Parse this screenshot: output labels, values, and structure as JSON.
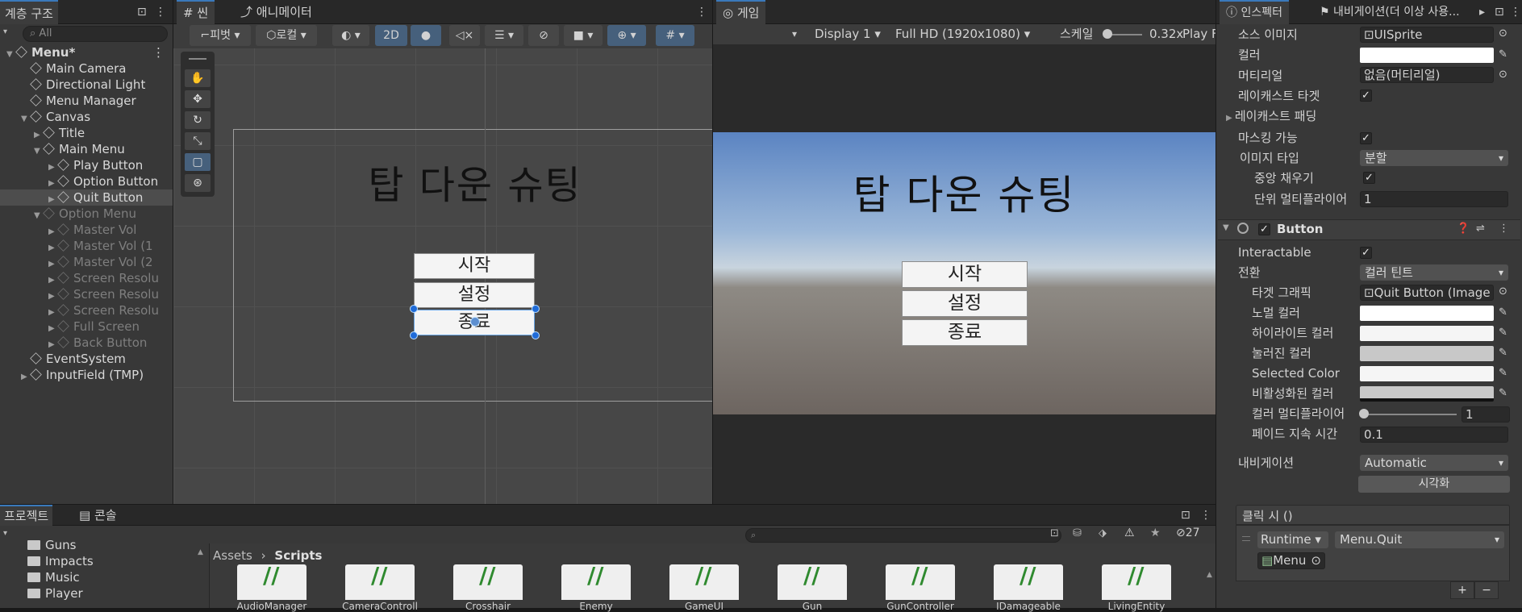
{
  "hierarchy": {
    "tab": "계층 구조",
    "search_placeholder": "All",
    "items": [
      {
        "label": "Menu*",
        "depth": 0,
        "state": "scene"
      },
      {
        "label": "Main Camera",
        "depth": 1,
        "state": "normal"
      },
      {
        "label": "Directional Light",
        "depth": 1,
        "state": "normal"
      },
      {
        "label": "Menu Manager",
        "depth": 1,
        "state": "normal"
      },
      {
        "label": "Canvas",
        "depth": 1,
        "state": "expanded"
      },
      {
        "label": "Title",
        "depth": 2,
        "state": "collapsed"
      },
      {
        "label": "Main Menu",
        "depth": 2,
        "state": "expanded"
      },
      {
        "label": "Play Button",
        "depth": 3,
        "state": "collapsed"
      },
      {
        "label": "Option Button",
        "depth": 3,
        "state": "collapsed"
      },
      {
        "label": "Quit Button",
        "depth": 3,
        "state": "selected"
      },
      {
        "label": "Option Menu",
        "depth": 2,
        "state": "dim-expanded"
      },
      {
        "label": "Master Vol",
        "depth": 3,
        "state": "dim"
      },
      {
        "label": "Master Vol (1",
        "depth": 3,
        "state": "dim"
      },
      {
        "label": "Master Vol (2",
        "depth": 3,
        "state": "dim"
      },
      {
        "label": "Screen Resolu",
        "depth": 3,
        "state": "dim"
      },
      {
        "label": "Screen Resolu",
        "depth": 3,
        "state": "dim"
      },
      {
        "label": "Screen Resolu",
        "depth": 3,
        "state": "dim"
      },
      {
        "label": "Full Screen",
        "depth": 3,
        "state": "dim"
      },
      {
        "label": "Back Button",
        "depth": 3,
        "state": "dim"
      },
      {
        "label": "EventSystem",
        "depth": 1,
        "state": "normal"
      },
      {
        "label": "InputField (TMP)",
        "depth": 1,
        "state": "collapsed"
      }
    ]
  },
  "scene": {
    "tab_scene": "씬",
    "tab_animator": "애니메이터",
    "pivot": "피벗",
    "local": "로컬",
    "mode_2d": "2D",
    "title": "탑 다운 슈팅",
    "buttons": [
      "시작",
      "설정",
      "종료"
    ]
  },
  "game": {
    "tab": "게임",
    "display": "Display 1",
    "resolution": "Full HD (1920x1080)",
    "scale_label": "스케일",
    "scale_value": "0.32x",
    "play_label": "Play F",
    "title": "탑 다운 슈팅",
    "buttons": [
      "시작",
      "설정",
      "종료"
    ]
  },
  "inspector": {
    "tab": "인스펙터",
    "tab_nav": "내비게이션(더 이상 사용...",
    "image": {
      "source_image_label": "소스 이미지",
      "source_image_value": "UISprite",
      "color_label": "컬러",
      "material_label": "머티리얼",
      "material_value": "없음(머티리얼)",
      "raycast_target_label": "레이캐스트 타겟",
      "raycast_padding_label": "레이캐스트 패딩",
      "maskable_label": "마스킹 가능",
      "image_type_label": "이미지 타입",
      "image_type_value": "분할",
      "fill_center_label": "중앙 채우기",
      "pixels_per_unit_label": "단위 멀티플라이어",
      "pixels_per_unit_value": "1"
    },
    "button": {
      "component_title": "Button",
      "interactable_label": "Interactable",
      "transition_label": "전환",
      "transition_value": "컬러 틴트",
      "target_graphic_label": "타겟 그래픽",
      "target_graphic_value": "Quit Button (Image",
      "normal_color_label": "노멀 컬러",
      "highlight_color_label": "하이라이트 컬러",
      "pressed_color_label": "눌러진 컬러",
      "selected_color_label": "Selected Color",
      "disabled_color_label": "비활성화된 컬러",
      "color_multiplier_label": "컬러 멀티플라이어",
      "color_multiplier_value": "1",
      "fade_duration_label": "페이드 지속 시간",
      "fade_duration_value": "0.1",
      "navigation_label": "내비게이션",
      "navigation_value": "Automatic",
      "visualize_label": "시각화",
      "onclick_label": "클릭 시 ()",
      "runtime_value": "Runtime",
      "function_value": "Menu.Quit",
      "object_value": "Menu"
    }
  },
  "project": {
    "tab_project": "프로젝트",
    "tab_console": "콘솔",
    "folders": [
      "Guns",
      "Impacts",
      "Music",
      "Player"
    ],
    "breadcrumb_root": "Assets",
    "breadcrumb_current": "Scripts",
    "hidden_count": "27",
    "scripts": [
      "AudioManager",
      "CameraControll",
      "Crosshair",
      "Enemy",
      "GameUI",
      "Gun",
      "GunController",
      "IDamageable",
      "LivingEntity"
    ]
  },
  "colors": {
    "accent": "#3a79bb",
    "panel": "#383838",
    "selection": "#4d4d4d"
  }
}
